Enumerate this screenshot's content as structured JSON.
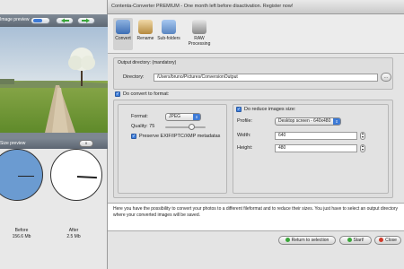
{
  "window": {
    "title": "Contenta-Converter PREMIUM - One month left before disactivation. Register now!"
  },
  "left_panel": {
    "image_preview_label": "Image preview",
    "size_preview_label": "Size preview",
    "pause_label": "II",
    "before": {
      "label": "Before",
      "value": "156.6 Mb"
    },
    "after": {
      "label": "After",
      "value": "2.5 Mb"
    }
  },
  "toolbar": {
    "items": [
      {
        "label": "Convert",
        "icon": "convert-icon"
      },
      {
        "label": "Rename",
        "icon": "rename-icon"
      },
      {
        "label": "Sub-folders",
        "icon": "subfolders-icon"
      },
      {
        "label": "RAW Processing",
        "icon": "raw-processing-icon"
      }
    ]
  },
  "output": {
    "section_title": "Output directory: (mandatory)",
    "directory_label": "Directory:",
    "directory_value": "/Users/bruno/Pictures/ConversionOutput",
    "browse_label": "..."
  },
  "convert": {
    "checkbox_label": "Do convert to format:",
    "format_label": "Format:",
    "format_value": "JPEG",
    "quality_label": "Quality: 75",
    "preserve_label": "Preserve EXIF/IPTC/XMP metadatas"
  },
  "reduce": {
    "checkbox_label": "Do reduce images size:",
    "profile_label": "Profile:",
    "profile_value": "Desktop screen - 640x480",
    "width_label": "Width:",
    "width_value": "640",
    "height_label": "Height:",
    "height_value": "480"
  },
  "description": "Here you have the possibility to convert your photos to a different fileformat and to reduce their sizes. You just have to select an output directory where your converted images will be saved.",
  "buttons": {
    "return": "Return to selection",
    "start": "Start!",
    "close": "Close"
  },
  "colors": {
    "accent": "#3d7ad6",
    "pie_before": "#6b9bd1"
  }
}
